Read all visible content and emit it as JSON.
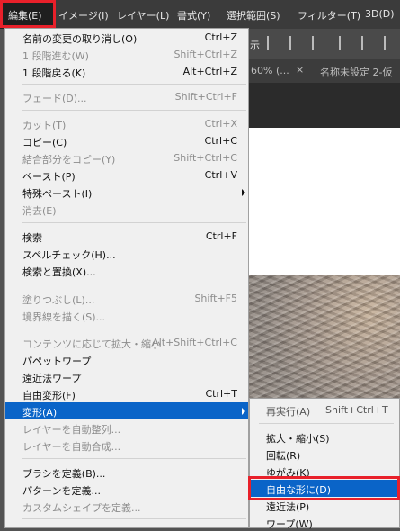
{
  "menubar": {
    "items": [
      "編集(E)",
      "イメージ(I)",
      "レイヤー(L)",
      "書式(Y)",
      "選択範囲(S)",
      "フィルター(T)",
      "3D(D)"
    ]
  },
  "options_bar": {
    "partial_label": "示"
  },
  "doc_tabs": {
    "zoom_fragment": "60% (...",
    "close_glyph": "×",
    "second_tab": "名称未設定 2-仮"
  },
  "edit_menu": {
    "items": [
      {
        "label": "名前の変更の取り消し(O)",
        "shortcut": "Ctrl+Z"
      },
      {
        "label": "1 段階進む(W)",
        "shortcut": "Shift+Ctrl+Z"
      },
      {
        "label": "1 段階戻る(K)",
        "shortcut": "Alt+Ctrl+Z"
      },
      {
        "label": "フェード(D)...",
        "shortcut": "Shift+Ctrl+F"
      },
      {
        "label": "カット(T)",
        "shortcut": "Ctrl+X"
      },
      {
        "label": "コピー(C)",
        "shortcut": "Ctrl+C"
      },
      {
        "label": "結合部分をコピー(Y)",
        "shortcut": "Shift+Ctrl+C"
      },
      {
        "label": "ペースト(P)",
        "shortcut": "Ctrl+V"
      },
      {
        "label": "特殊ペースト(I)",
        "shortcut": ""
      },
      {
        "label": "消去(E)",
        "shortcut": ""
      },
      {
        "label": "検索",
        "shortcut": "Ctrl+F"
      },
      {
        "label": "スペルチェック(H)...",
        "shortcut": ""
      },
      {
        "label": "検索と置換(X)...",
        "shortcut": ""
      },
      {
        "label": "塗りつぶし(L)...",
        "shortcut": "Shift+F5"
      },
      {
        "label": "境界線を描く(S)...",
        "shortcut": ""
      },
      {
        "label": "コンテンツに応じて拡大・縮小",
        "shortcut": "Alt+Shift+Ctrl+C"
      },
      {
        "label": "パペットワープ",
        "shortcut": ""
      },
      {
        "label": "遠近法ワープ",
        "shortcut": ""
      },
      {
        "label": "自由変形(F)",
        "shortcut": "Ctrl+T"
      },
      {
        "label": "変形(A)",
        "shortcut": ""
      },
      {
        "label": "レイヤーを自動整列...",
        "shortcut": ""
      },
      {
        "label": "レイヤーを自動合成...",
        "shortcut": ""
      },
      {
        "label": "ブラシを定義(B)...",
        "shortcut": ""
      },
      {
        "label": "パターンを定義...",
        "shortcut": ""
      },
      {
        "label": "カスタムシェイプを定義...",
        "shortcut": ""
      }
    ]
  },
  "transform_submenu": {
    "items": [
      {
        "label": "再実行(A)",
        "shortcut": "Shift+Ctrl+T"
      },
      {
        "label": "拡大・縮小(S)",
        "shortcut": ""
      },
      {
        "label": "回転(R)",
        "shortcut": ""
      },
      {
        "label": "ゆがみ(K)",
        "shortcut": ""
      },
      {
        "label": "自由な形に(D)",
        "shortcut": ""
      },
      {
        "label": "遠近法(P)",
        "shortcut": ""
      },
      {
        "label": "ワープ(W)",
        "shortcut": ""
      }
    ]
  },
  "colors": {
    "highlight": "#0a64c8",
    "callout": "#e8202a",
    "menu_bg": "#f0f0f0",
    "menubar_bg": "#3b3b3b"
  }
}
